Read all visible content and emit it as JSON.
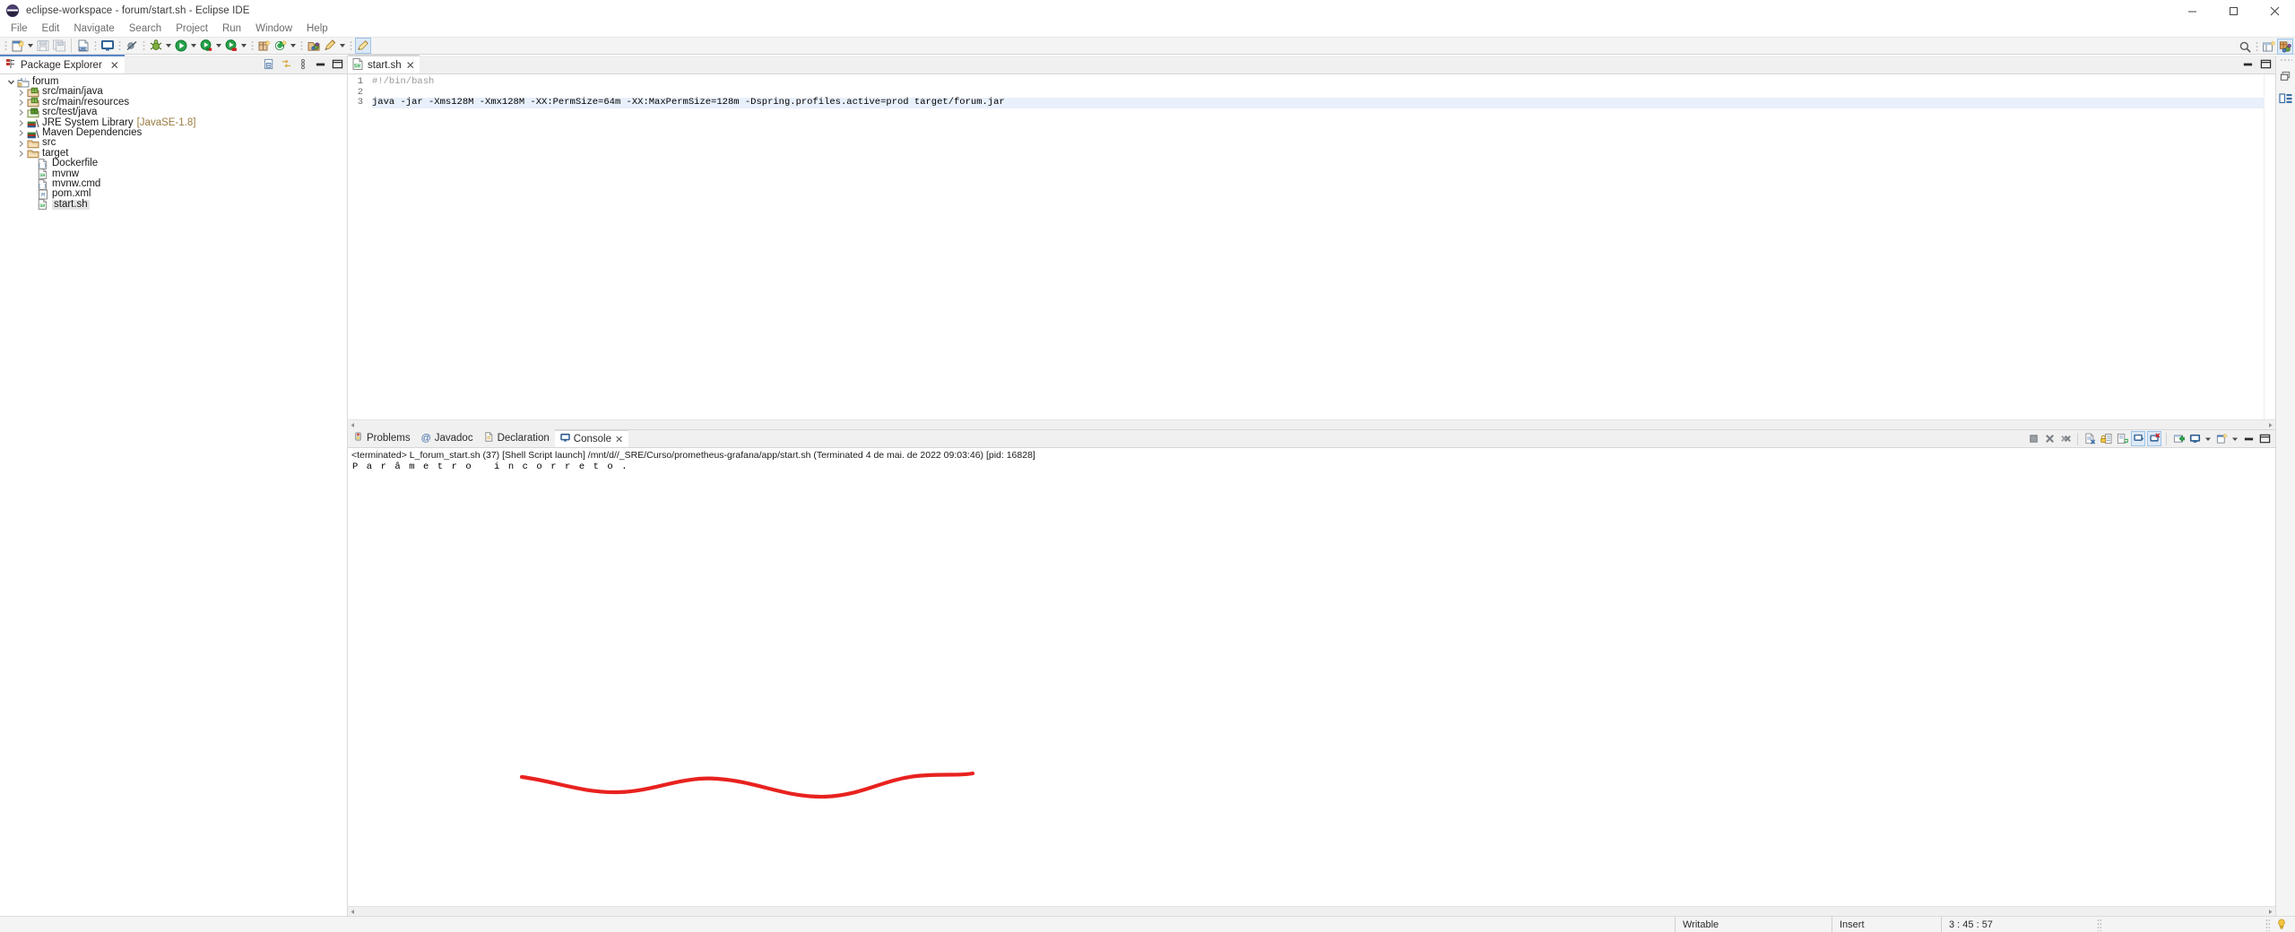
{
  "window": {
    "title": "eclipse-workspace - forum/start.sh - Eclipse IDE",
    "icon": "eclipse-globe-icon",
    "minimize_label": "—",
    "maximize_label": "❐",
    "close_label": "✕"
  },
  "menubar": {
    "items": [
      {
        "label": "File"
      },
      {
        "label": "Edit"
      },
      {
        "label": "Navigate"
      },
      {
        "label": "Search"
      },
      {
        "label": "Project"
      },
      {
        "label": "Run"
      },
      {
        "label": "Window"
      },
      {
        "label": "Help"
      }
    ]
  },
  "toolbar": {
    "buttons": [
      {
        "name": "new-wizard-icon",
        "has_arrow": true
      },
      {
        "name": "save-icon",
        "has_arrow": false
      },
      {
        "name": "save-all-icon",
        "has_arrow": false
      },
      {
        "name": "new-java-file-icon",
        "has_arrow": false
      },
      {
        "name": "open-console-icon",
        "has_arrow": false
      },
      {
        "name": "skip-breakpoints-icon",
        "has_arrow": false
      },
      {
        "name": "debug-icon",
        "has_arrow": true
      },
      {
        "name": "run-icon",
        "has_arrow": true
      },
      {
        "name": "run-external-tools-icon",
        "has_arrow": true
      },
      {
        "name": "coverage-icon",
        "has_arrow": true
      },
      {
        "name": "new-package-icon",
        "has_arrow": false
      },
      {
        "name": "new-class-icon",
        "has_arrow": true
      },
      {
        "name": "open-type-icon",
        "has_arrow": false
      },
      {
        "name": "search-annotation-icon",
        "has_arrow": true
      },
      {
        "name": "edit-highlight-icon",
        "has_arrow": false
      }
    ],
    "right_buttons": [
      {
        "name": "quick-access-search-icon"
      },
      {
        "name": "open-perspective-icon"
      },
      {
        "name": "java-perspective-icon",
        "selected": true
      }
    ]
  },
  "package_explorer": {
    "tab_label": "Package Explorer",
    "tab_icon": "package-explorer-icon",
    "close_icon": "close-icon",
    "view_tools": [
      {
        "name": "collapse-all-icon"
      },
      {
        "name": "link-with-editor-icon"
      },
      {
        "name": "view-menu-icon"
      },
      {
        "name": "minimize-icon"
      },
      {
        "name": "maximize-icon"
      }
    ],
    "tree": [
      {
        "label": "forum",
        "icon": "maven-java-project-icon",
        "depth": 0,
        "twisty": "expanded",
        "selected": false
      },
      {
        "label": "src/main/java",
        "icon": "source-folder-icon",
        "depth": 1,
        "twisty": "collapsed",
        "selected": false
      },
      {
        "label": "src/main/resources",
        "icon": "source-folder-icon",
        "depth": 1,
        "twisty": "collapsed",
        "selected": false
      },
      {
        "label": "src/test/java",
        "icon": "test-source-folder-icon",
        "depth": 1,
        "twisty": "collapsed",
        "selected": false
      },
      {
        "label": "JRE System Library",
        "sub": "[JavaSE-1.8]",
        "icon": "library-icon",
        "depth": 1,
        "twisty": "collapsed",
        "selected": false
      },
      {
        "label": "Maven Dependencies",
        "icon": "library-icon",
        "depth": 1,
        "twisty": "collapsed",
        "selected": false
      },
      {
        "label": "src",
        "icon": "folder-icon",
        "depth": 1,
        "twisty": "collapsed",
        "selected": false
      },
      {
        "label": "target",
        "icon": "folder-icon",
        "depth": 1,
        "twisty": "collapsed",
        "selected": false
      },
      {
        "label": "Dockerfile",
        "icon": "generic-file-icon",
        "depth": 2,
        "twisty": "none",
        "selected": false
      },
      {
        "label": "mvnw",
        "icon": "shell-script-icon",
        "depth": 2,
        "twisty": "none",
        "selected": false
      },
      {
        "label": "mvnw.cmd",
        "icon": "generic-file-icon",
        "depth": 2,
        "twisty": "none",
        "selected": false
      },
      {
        "label": "pom.xml",
        "icon": "maven-pom-icon",
        "depth": 2,
        "twisty": "none",
        "selected": false
      },
      {
        "label": "start.sh",
        "icon": "shell-script-icon",
        "depth": 2,
        "twisty": "none",
        "selected": true
      }
    ]
  },
  "editor": {
    "tab": {
      "label": "start.sh",
      "icon": "shell-script-icon",
      "close_icon": "close-icon"
    },
    "tools": [
      {
        "name": "minimize-icon"
      },
      {
        "name": "maximize-icon"
      }
    ],
    "lines": [
      {
        "num": "1",
        "text": "#!/bin/bash",
        "style": "comment",
        "highlight": false
      },
      {
        "num": "2",
        "text": "",
        "style": "plain",
        "highlight": false
      },
      {
        "num": "3",
        "text": "java -jar -Xms128M -Xmx128M -XX:PermSize=64m -XX:MaxPermSize=128m -Dspring.profiles.active=prod target/forum.jar",
        "style": "plain",
        "highlight": true
      }
    ]
  },
  "bottom_panel": {
    "tabs": [
      {
        "label": "Problems",
        "icon": "problems-icon",
        "active": false
      },
      {
        "label": "Javadoc",
        "icon": "javadoc-icon",
        "active": false
      },
      {
        "label": "Declaration",
        "icon": "declaration-icon",
        "active": false
      },
      {
        "label": "Console",
        "icon": "console-icon",
        "active": true,
        "close_icon": "close-icon"
      }
    ],
    "tools": [
      {
        "name": "terminate-icon",
        "selected": false
      },
      {
        "name": "remove-launch-icon",
        "selected": false
      },
      {
        "name": "remove-all-terminated-icon",
        "selected": false
      },
      {
        "name": "clear-console-icon",
        "selected": false
      },
      {
        "name": "scroll-lock-icon",
        "selected": false
      },
      {
        "name": "word-wrap-icon",
        "selected": false
      },
      {
        "name": "pin-console-icon",
        "selected": true
      },
      {
        "name": "display-selected-console-icon",
        "selected": true
      },
      {
        "name": "open-console-icon",
        "selected": false
      },
      {
        "name": "console-view-menu-icon",
        "selected": false
      },
      {
        "name": "new-console-view-icon",
        "selected": false
      },
      {
        "name": "minimize-icon",
        "selected": false
      },
      {
        "name": "maximize-icon",
        "selected": false
      }
    ],
    "console": {
      "header": "<terminated> L_forum_start.sh (37) [Shell Script launch] /mnt/d//_SRE/Curso/prometheus-grafana/app/start.sh (Terminated 4 de mai. de 2022 09:03:46) [pid: 16828]",
      "output": "P a r â m e t r o   i n c o r r e t o ."
    }
  },
  "perspective_bar": {
    "buttons": [
      {
        "name": "restore-icon"
      },
      {
        "name": "package-explorer-shortcut-icon"
      }
    ]
  },
  "statusbar": {
    "writable": "Writable",
    "insert_mode": "Insert",
    "cursor_position": "3 : 45 : 57",
    "tip_icon": "lightbulb-icon"
  },
  "annotation": {
    "color": "#e8221f",
    "name": "red-underline-scribble"
  }
}
